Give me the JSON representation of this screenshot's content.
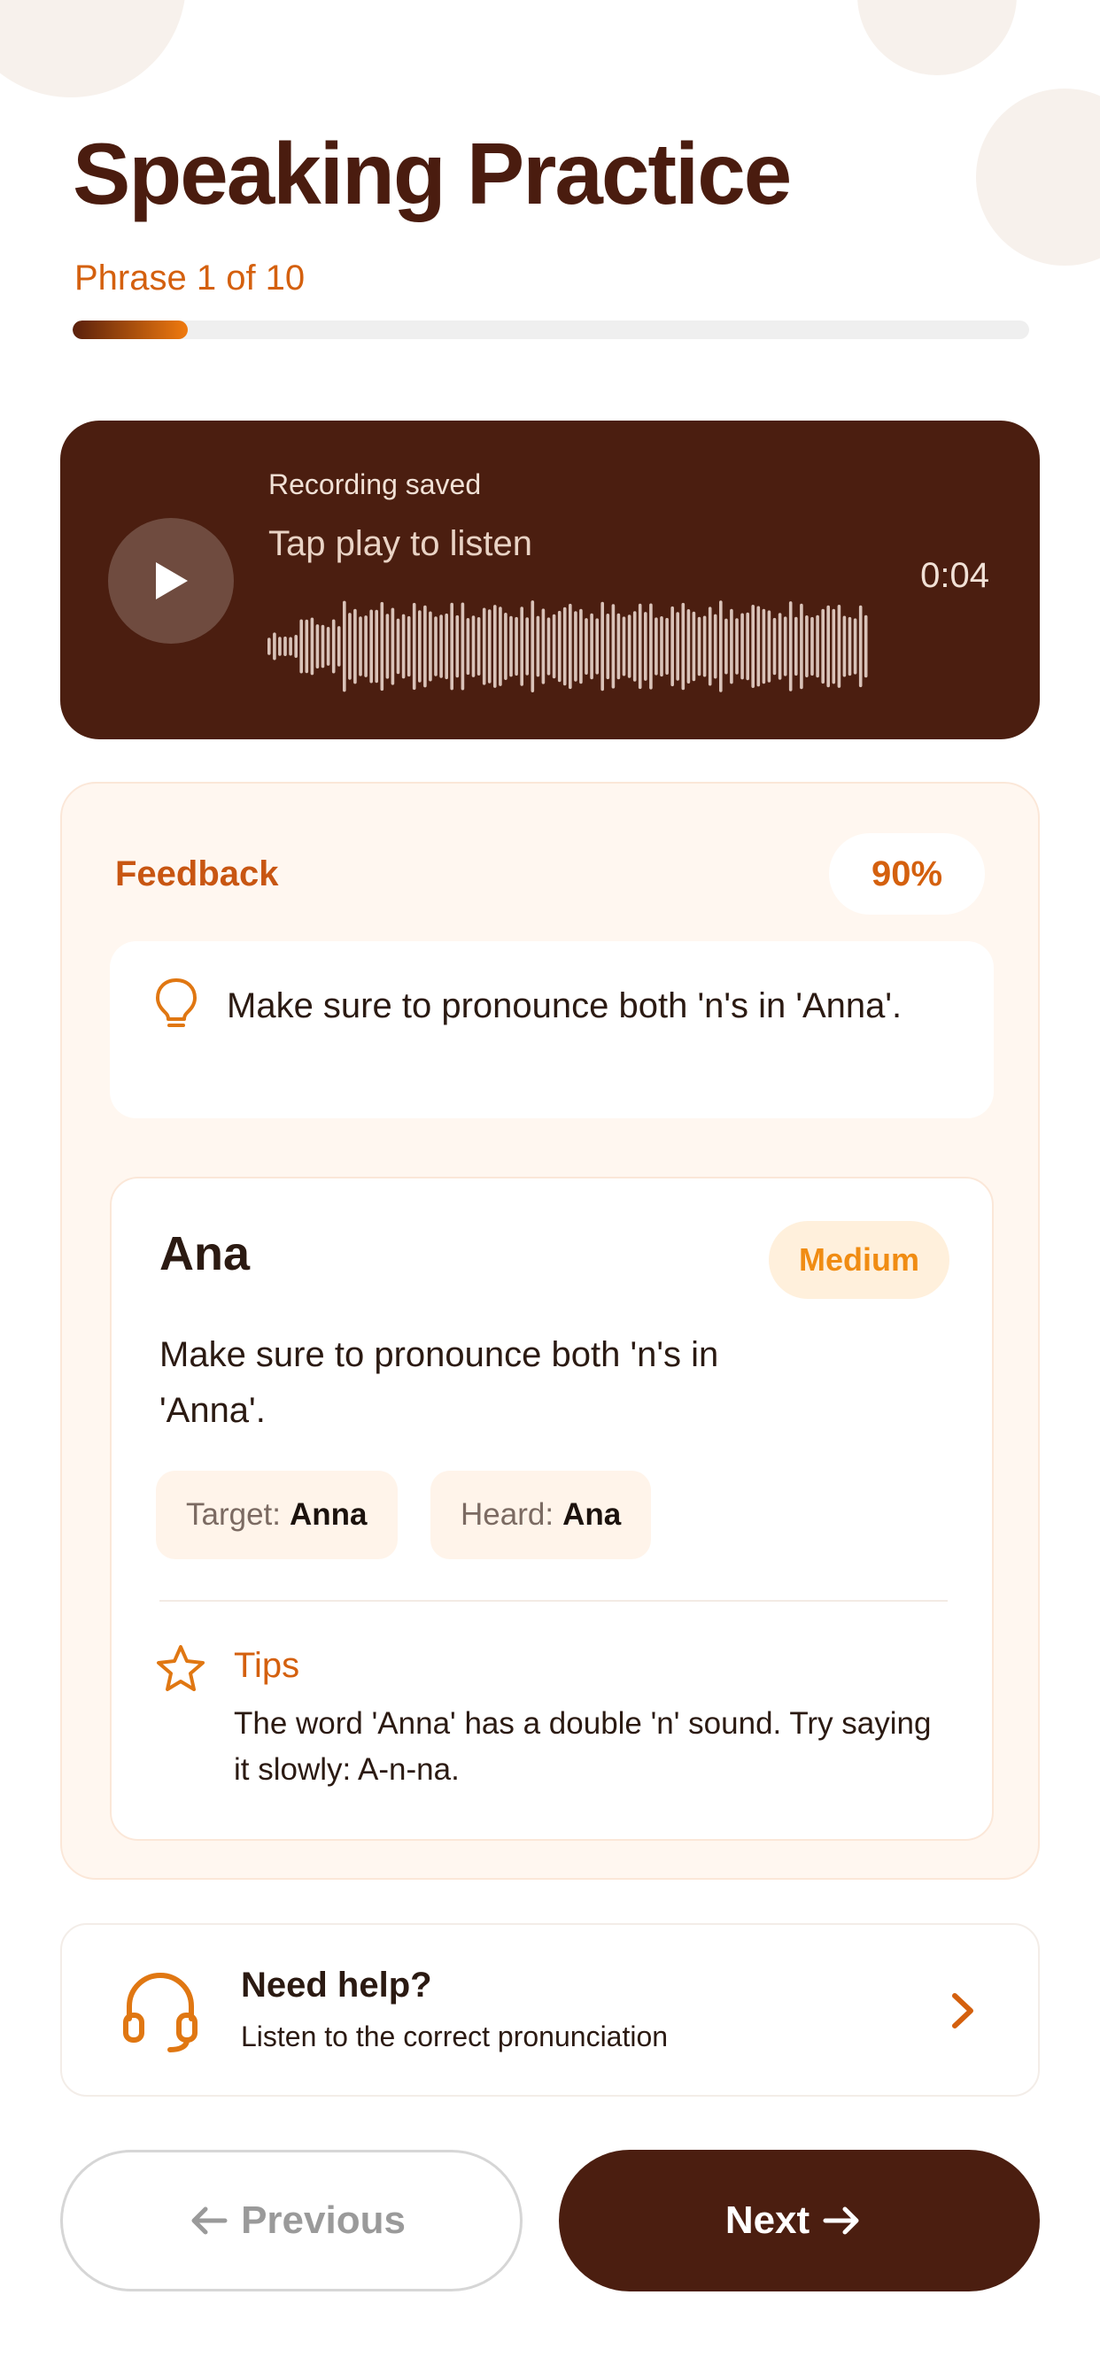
{
  "header": {
    "title": "Speaking Practice",
    "phrase_counter": "Phrase 1 of 10",
    "progress_fraction": 0.1
  },
  "recording": {
    "status": "Recording saved",
    "hint": "Tap play to listen",
    "duration": "0:04"
  },
  "feedback": {
    "label": "Feedback",
    "score": "90%",
    "hint": "Make sure to pronounce both 'n's in 'Anna'.",
    "word_card": {
      "word": "Ana",
      "difficulty": "Medium",
      "message": "Make sure to pronounce both 'n's in 'Anna'.",
      "target_label": "Target:",
      "target_value": "Anna",
      "heard_label": "Heard:",
      "heard_value": "Ana",
      "tips_title": "Tips",
      "tips_text": "The word 'Anna' has a double 'n' sound. Try saying it slowly: A-n-na."
    }
  },
  "help": {
    "title": "Need help?",
    "subtitle": "Listen to the correct pronunciation"
  },
  "navigation": {
    "previous_label": "Previous",
    "next_label": "Next"
  },
  "colors": {
    "accent": "#d4600e",
    "dark_brown": "#4b1e10",
    "panel_bg": "#fff7f0",
    "difficulty_text": "#f08c13"
  }
}
